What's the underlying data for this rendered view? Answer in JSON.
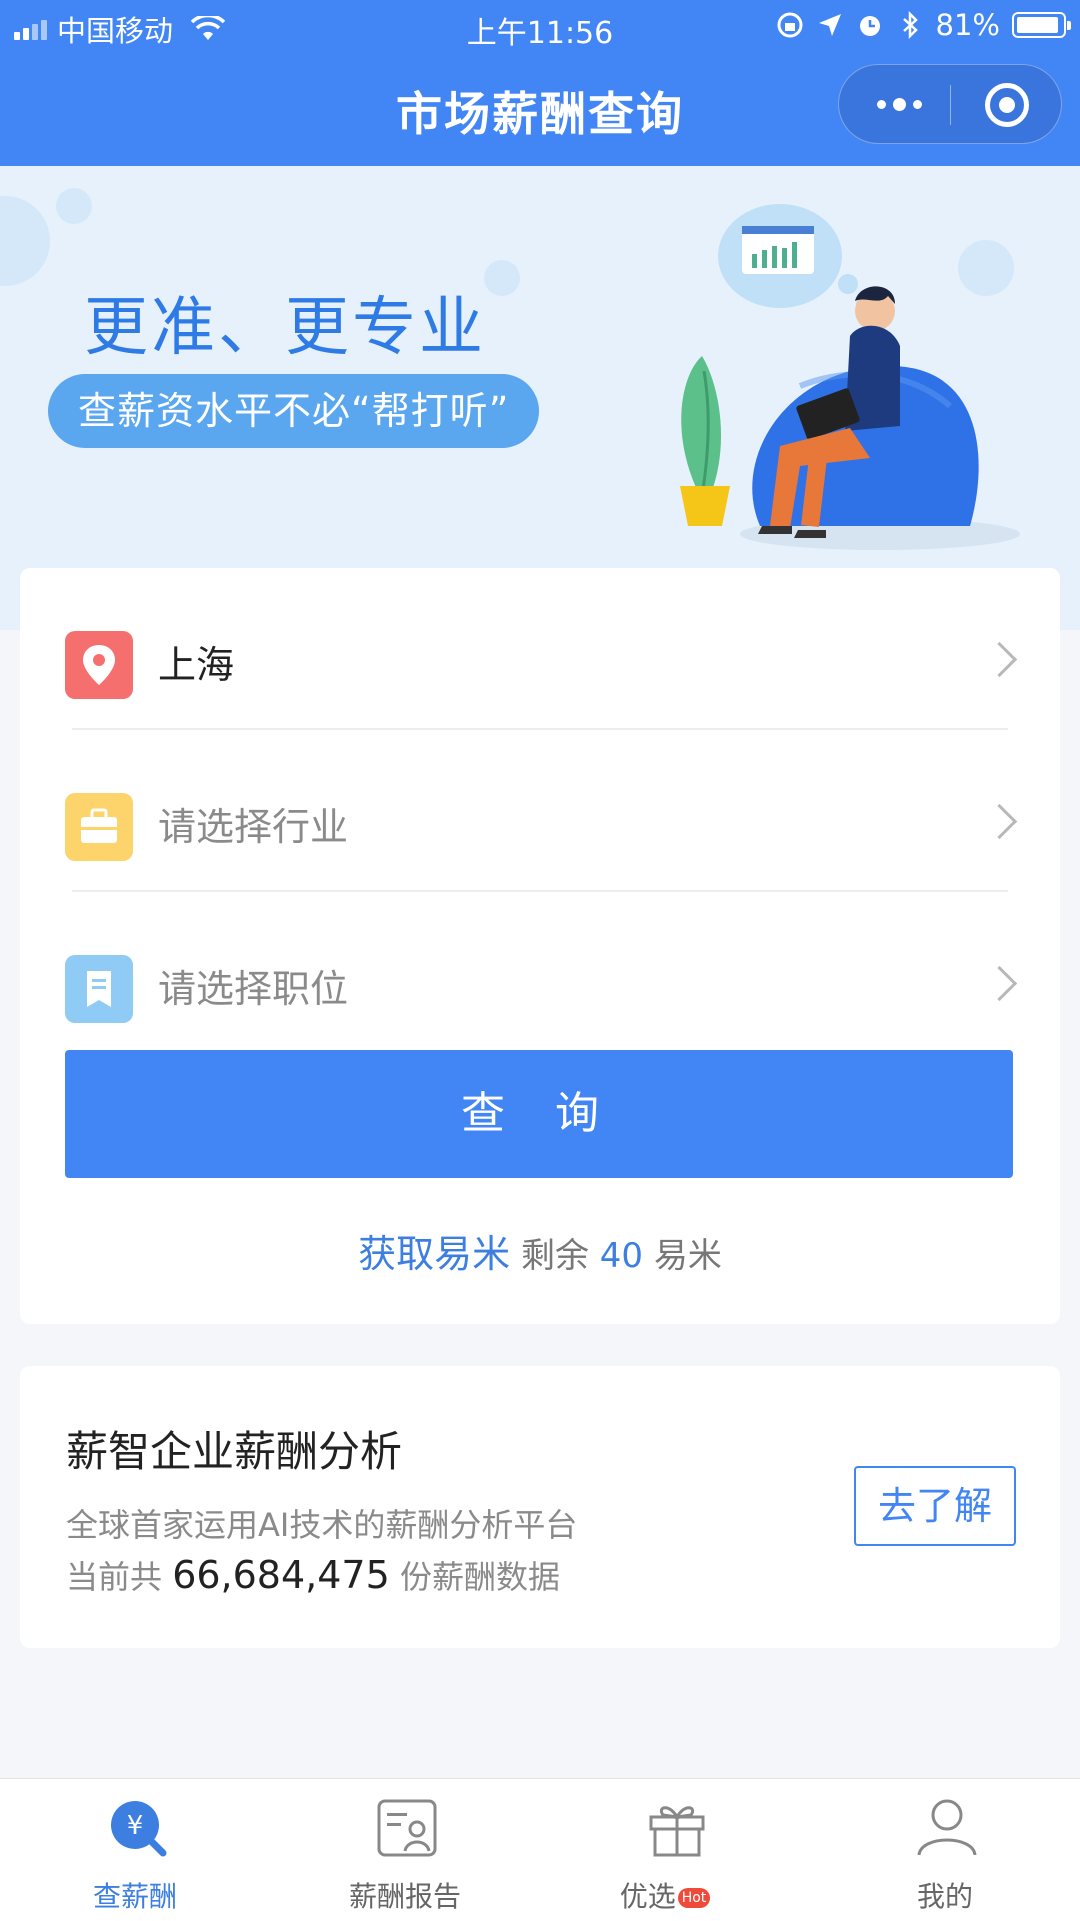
{
  "status_bar": {
    "carrier": "中国移动",
    "time": "上午11:56",
    "battery": "81%"
  },
  "nav": {
    "title": "市场薪酬查询"
  },
  "banner": {
    "headline": "更准、更专业",
    "tagline": "查薪资水平不必“帮打听”"
  },
  "query": {
    "city": "上海",
    "industry_placeholder": "请选择行业",
    "position_placeholder": "请选择职位",
    "button_label": "查 询",
    "credits": {
      "link": "获取易米",
      "remaining_label": "剩余",
      "remaining_value": "40",
      "unit": "易米"
    }
  },
  "analysis": {
    "title": "薪智企业薪酬分析",
    "subtitle": "全球首家运用AI技术的薪酬分析平台",
    "count_prefix": "当前共",
    "count_value": "66,684,475",
    "count_suffix": "份薪酬数据",
    "button_label": "去了解"
  },
  "tabbar": {
    "items": [
      {
        "label": "查薪酬",
        "icon": "yuan-search-icon",
        "active": true
      },
      {
        "label": "薪酬报告",
        "icon": "report-icon",
        "active": false
      },
      {
        "label": "优选",
        "icon": "gift-icon",
        "badge": "Hot",
        "active": false
      },
      {
        "label": "我的",
        "icon": "user-icon",
        "active": false
      }
    ]
  },
  "colors": {
    "primary": "#4285f4",
    "banner_bg": "#e6f1fc",
    "location_icon": "#f66f6f",
    "industry_icon": "#fdd36b",
    "position_icon": "#8fcbf5"
  }
}
